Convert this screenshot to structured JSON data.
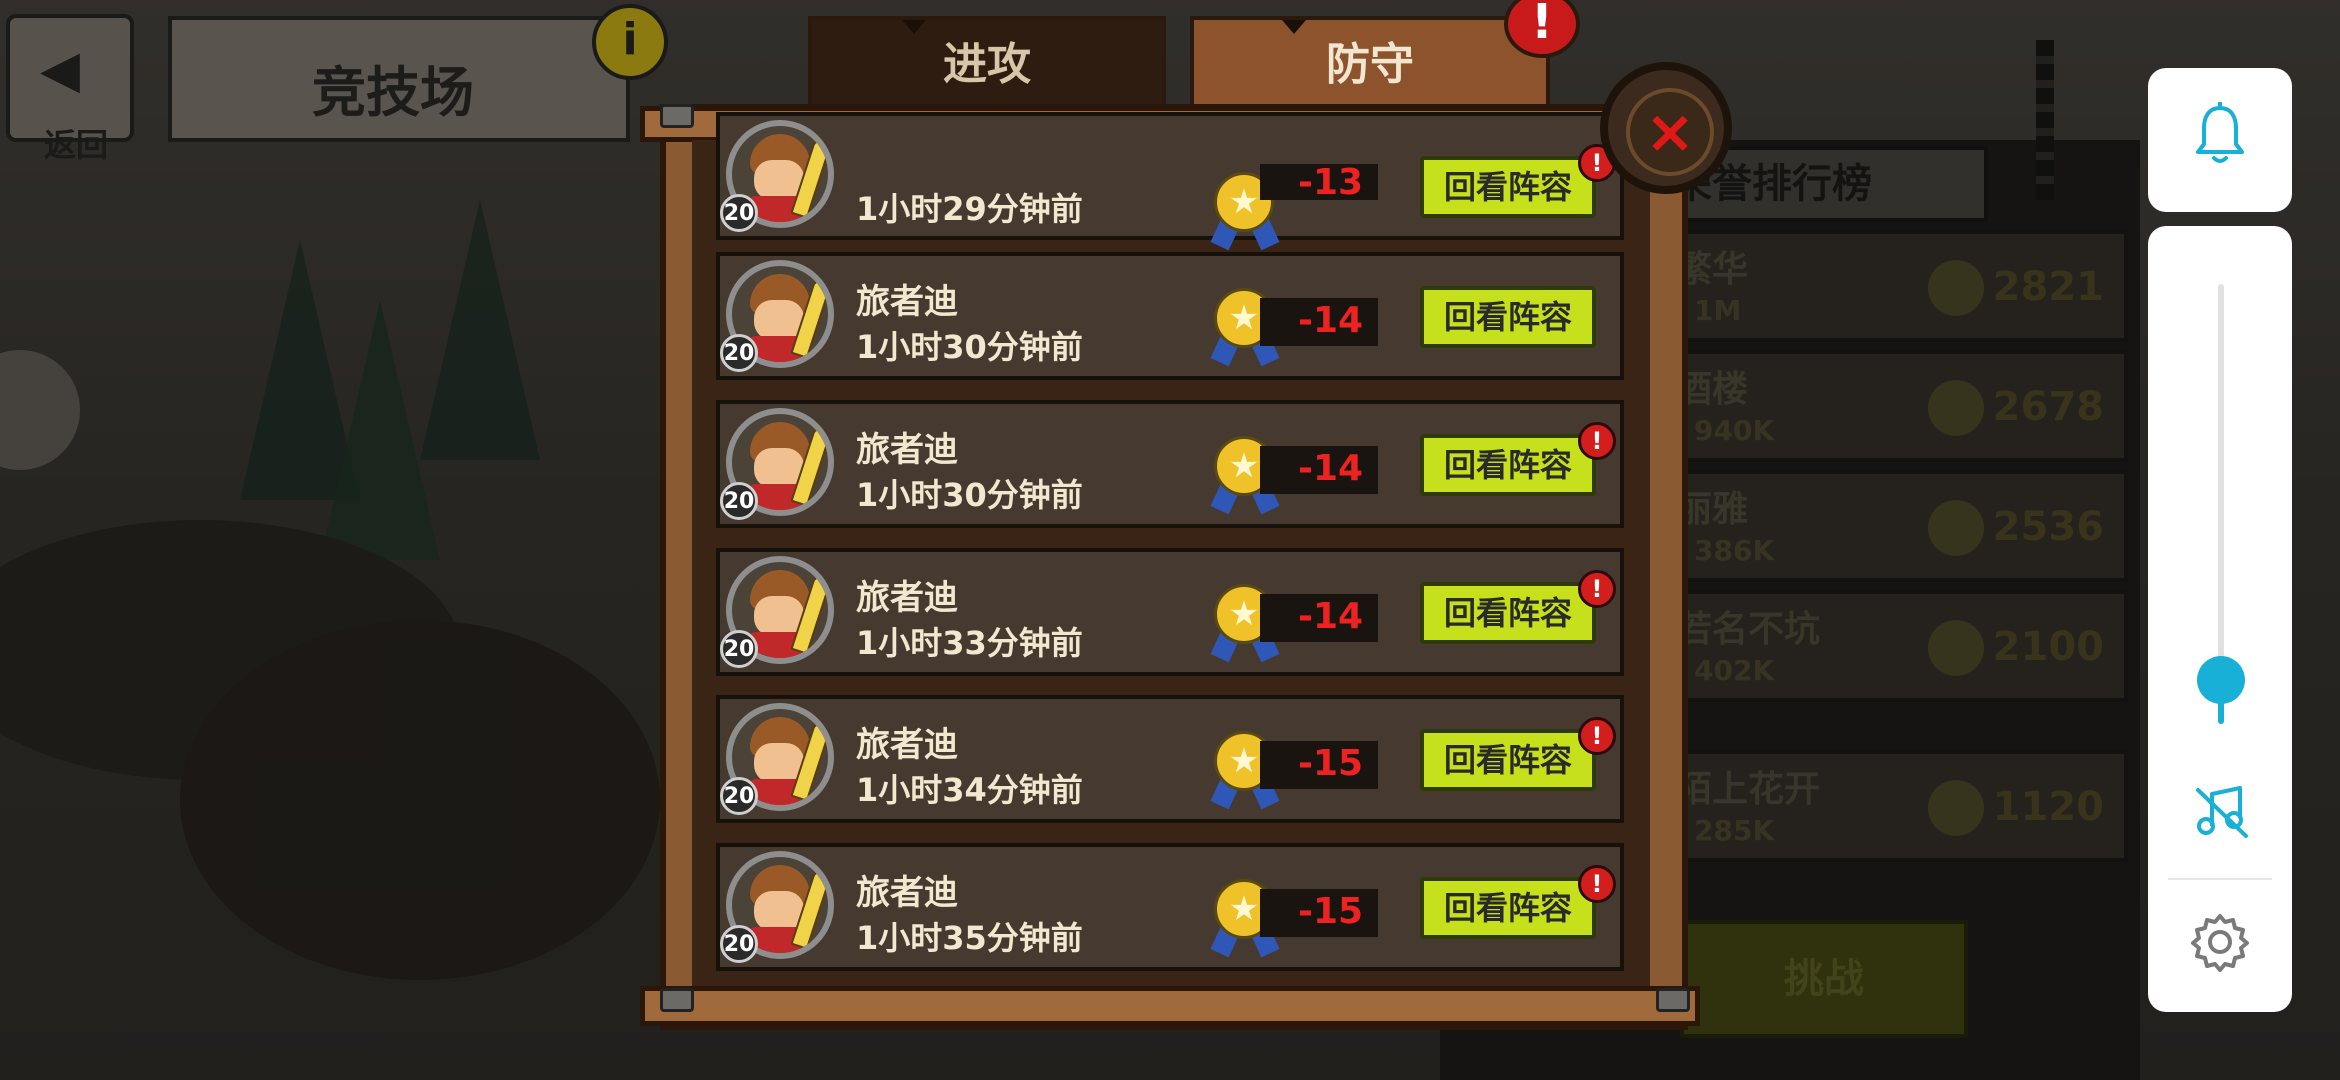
{
  "top_nav": {
    "back_label": "返回",
    "title": "竞技场",
    "info_label": "i"
  },
  "tabs": [
    {
      "label": "进攻",
      "active": false
    },
    {
      "label": "防守",
      "active": true
    }
  ],
  "alert_label": "!",
  "close_label": "×",
  "history": {
    "rows": [
      {
        "name": "",
        "level": "20",
        "time": "1小时29分钟前",
        "score": "-13",
        "button": "回看阵容",
        "alert": true
      },
      {
        "name": "旅者迪",
        "level": "20",
        "time": "1小时30分钟前",
        "score": "-14",
        "button": "回看阵容",
        "alert": false
      },
      {
        "name": "旅者迪",
        "level": "20",
        "time": "1小时30分钟前",
        "score": "-14",
        "button": "回看阵容",
        "alert": true
      },
      {
        "name": "旅者迪",
        "level": "20",
        "time": "1小时33分钟前",
        "score": "-14",
        "button": "回看阵容",
        "alert": true
      },
      {
        "name": "旅者迪",
        "level": "20",
        "time": "1小时34分钟前",
        "score": "-15",
        "button": "回看阵容",
        "alert": true
      },
      {
        "name": "旅者迪",
        "level": "20",
        "time": "1小时35分钟前",
        "score": "-15",
        "button": "回看阵容",
        "alert": true
      }
    ]
  },
  "leaderboard": {
    "title": "荣誉排行榜",
    "rows": [
      {
        "name": "繁华",
        "power": "1M",
        "score": "2821"
      },
      {
        "name": "酒楼",
        "power": "940K",
        "score": "2678"
      },
      {
        "name": "丽雅",
        "power": "386K",
        "score": "2536"
      },
      {
        "name": "若名不坑",
        "power": "402K",
        "score": "2100"
      },
      {
        "name": "陌上花开",
        "power": "285K",
        "score": "1120"
      }
    ],
    "challenge_label": "挑战"
  },
  "system_panel": {
    "icons": [
      "bell-icon",
      "music-off-icon",
      "gear-icon"
    ],
    "accent_color": "#19b0d8",
    "volume_level": 0.1
  }
}
